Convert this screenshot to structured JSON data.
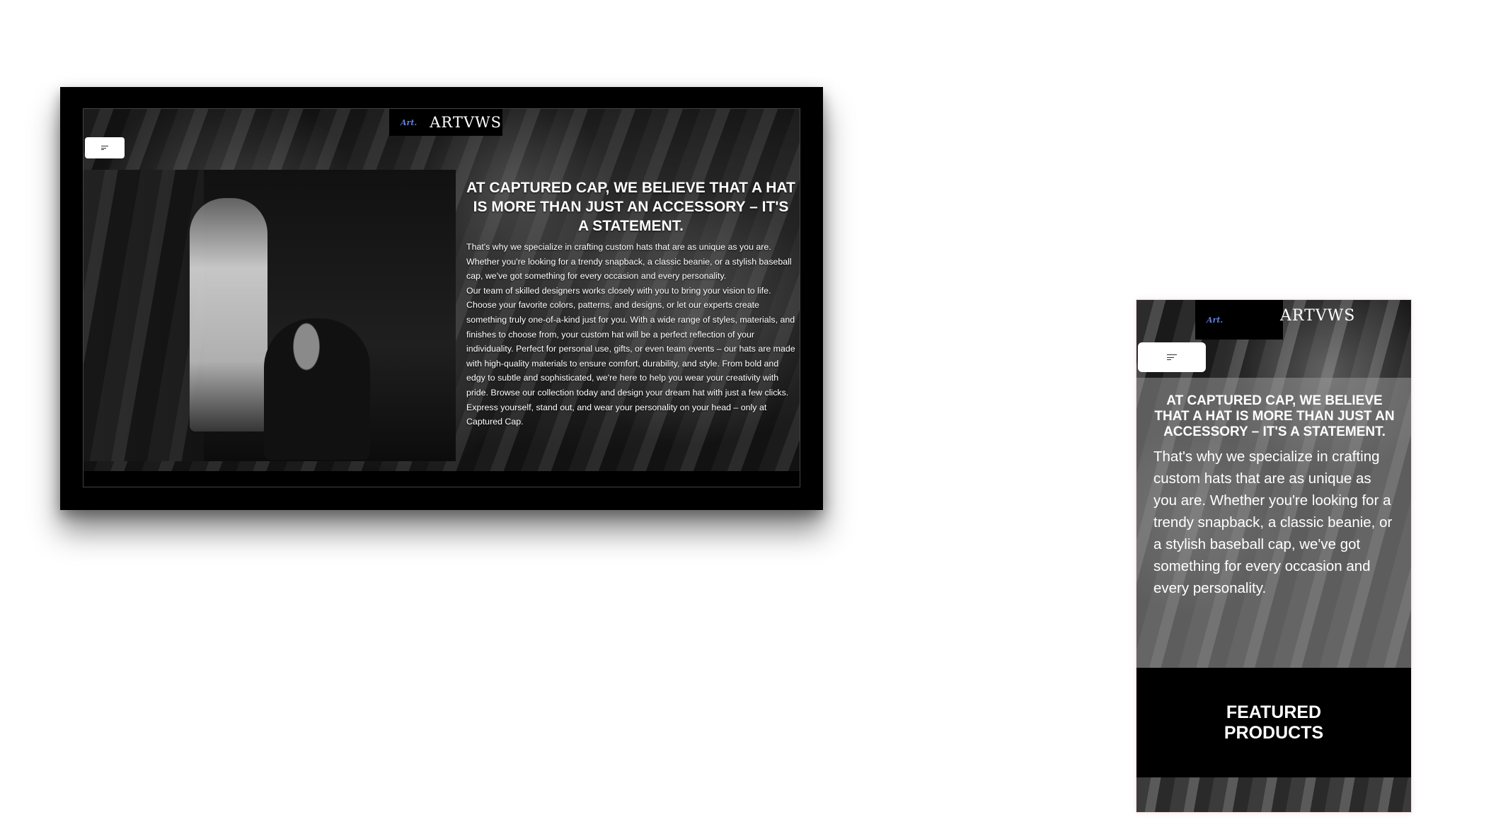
{
  "brand": {
    "script_mark": "Art.",
    "name": "ARTVWS"
  },
  "desktop": {
    "headline": "AT CAPTURED CAP, WE BELIEVE THAT A HAT IS MORE THAN JUST AN ACCESSORY – IT'S A STATEMENT.",
    "paragraph_1": "That's why we specialize in crafting custom hats that are as unique as you are. Whether you're looking for a trendy snapback, a classic beanie, or a stylish baseball cap, we've got something for every occasion and every personality.",
    "paragraph_2": "Our team of skilled designers works closely with you to bring your vision to life. Choose your favorite colors, patterns, and designs, or let our experts create something truly one-of-a-kind just for you. With a wide range of styles, materials, and finishes to choose from, your custom hat will be a perfect reflection of your individuality. Perfect for personal use, gifts, or even team events – our hats are made with high-quality materials to ensure comfort, durability, and style. From bold and edgy to subtle and sophisticated, we're here to help you wear your creativity with pride. Browse our collection today and design your dream hat with just a few clicks. Express yourself, stand out, and wear your personality on your head – only at Captured Cap."
  },
  "mobile": {
    "headline": "AT CAPTURED CAP, WE BELIEVE THAT A HAT IS MORE THAN JUST AN ACCESSORY – IT'S A STATEMENT.",
    "paragraph": "That's why we specialize in crafting custom hats that are as unique as you are. Whether you're looking for a trendy snapback, a classic beanie, or a stylish baseball cap, we've got something for every occasion and every personality.",
    "featured_title": "FEATURED PRODUCTS"
  },
  "icons": {
    "menu": "menu-icon"
  },
  "colors": {
    "logo_accent": "#5b7fd6",
    "background_dark": "#000000",
    "text_light": "#ffffff"
  }
}
